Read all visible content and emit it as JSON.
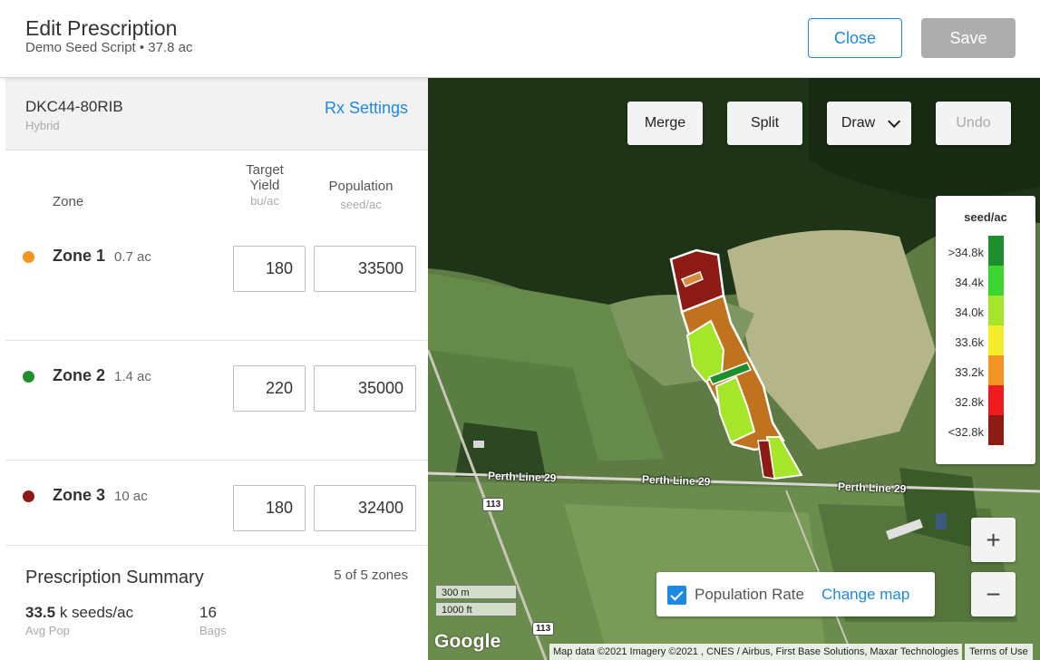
{
  "header": {
    "title": "Edit Prescription",
    "subtitle": "Demo Seed Script • 37.8 ac",
    "close_label": "Close",
    "save_label": "Save"
  },
  "hybrid": {
    "name": "DKC44-80RIB",
    "type": "Hybrid",
    "settings_label": "Rx Settings"
  },
  "columns": {
    "zone": "Zone",
    "yield_line1": "Target",
    "yield_line2": "Yield",
    "yield_unit": "bu/ac",
    "population": "Population",
    "population_unit": "seed/ac"
  },
  "zones": [
    {
      "name": "Zone 1",
      "area": "0.7 ac",
      "color": "#f39423",
      "target_yield": "180",
      "population": "33500"
    },
    {
      "name": "Zone 2",
      "area": "1.4 ac",
      "color": "#1f8f2d",
      "target_yield": "220",
      "population": "35000"
    },
    {
      "name": "Zone 3",
      "area": "10 ac",
      "color": "#8e1a16",
      "target_yield": "180",
      "population": "32400"
    }
  ],
  "summary": {
    "title": "Prescription Summary",
    "zone_count": "5 of 5 zones",
    "avg_pop_value": "33.5",
    "avg_pop_unit": "k seeds/ac",
    "avg_pop_label": "Avg Pop",
    "bags_value": "16",
    "bags_label": "Bags"
  },
  "map": {
    "buttons": {
      "merge": "Merge",
      "split": "Split",
      "draw": "Draw",
      "undo": "Undo"
    },
    "legend": {
      "title": "seed/ac",
      "items": [
        {
          "label": ">34.8k",
          "color": "#1f8f2d"
        },
        {
          "label": "34.4k",
          "color": "#3dd62f"
        },
        {
          "label": "34.0k",
          "color": "#a6e62a"
        },
        {
          "label": "33.6k",
          "color": "#f6ec2b"
        },
        {
          "label": "33.2k",
          "color": "#f39423"
        },
        {
          "label": "32.8k",
          "color": "#ee1c1c"
        },
        {
          "label": "<32.8k",
          "color": "#8e1a16"
        }
      ]
    },
    "layer": {
      "checked": true,
      "label": "Population Rate",
      "change_label": "Change map"
    },
    "zoom_in": "+",
    "zoom_out": "−",
    "scale_m": "300 m",
    "scale_ft": "1000 ft",
    "road_label": "Perth Line 29",
    "highway_number": "113",
    "google_logo": "Google",
    "attribution": "Map data ©2021 Imagery ©2021 , CNES / Airbus, First Base Solutions, Maxar Technologies",
    "terms": "Terms of Use"
  }
}
